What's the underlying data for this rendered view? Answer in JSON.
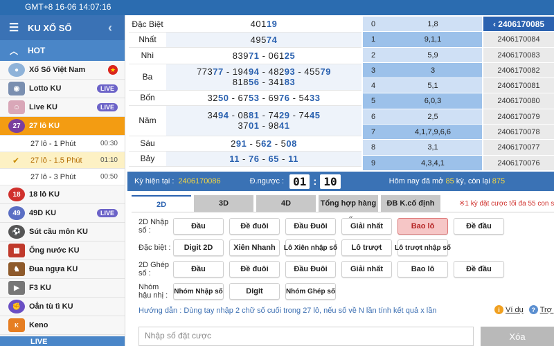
{
  "topbar": {
    "time": "GMT+8 16-06 14:07:16"
  },
  "sidebar": {
    "title": "KU XỔ SỐ",
    "hot_label": "HOT",
    "items": [
      {
        "label": "Xổ Số Việt Nam",
        "icon": "vietnam-flag-icon",
        "badge": ""
      },
      {
        "label": "Lotto KU",
        "icon": "lotto-icon",
        "badge": "LIVE"
      },
      {
        "label": "Live KU",
        "icon": "live-host-icon",
        "badge": "LIVE"
      },
      {
        "label": "27 lô KU",
        "icon": "27-lo-icon",
        "badge": ""
      }
    ],
    "sub_items": [
      {
        "label": "27 lô - 1 Phút",
        "time": "00:30"
      },
      {
        "label": "27 lô - 1.5 Phút",
        "time": "01:10"
      },
      {
        "label": "27 lô - 3 Phút",
        "time": "00:50"
      }
    ],
    "items2": [
      {
        "label": "18 lô KU",
        "badge": ""
      },
      {
        "label": "49D KU",
        "badge": "LIVE"
      },
      {
        "label": "Sút cầu môn KU",
        "badge": ""
      },
      {
        "label": "Ống nước KU",
        "badge": ""
      },
      {
        "label": "Đua ngựa KU",
        "badge": ""
      },
      {
        "label": "F3 KU",
        "badge": ""
      },
      {
        "label": "Oẳn tù tì KU",
        "badge": ""
      },
      {
        "label": "Keno",
        "badge": ""
      }
    ],
    "bottom_label": "LIVE"
  },
  "results": [
    {
      "label": "Đặc Biệt",
      "lines": [
        [
          "401",
          "19"
        ]
      ]
    },
    {
      "label": "Nhất",
      "lines": [
        [
          "495",
          "74"
        ]
      ]
    },
    {
      "label": "Nhì",
      "lines": [
        [
          "839",
          "71",
          " - ",
          "061",
          "25"
        ]
      ]
    },
    {
      "label": "Ba",
      "lines": [
        [
          "773",
          "77",
          " - ",
          "194",
          "94",
          " - ",
          "482",
          "93",
          " - ",
          "455",
          "79"
        ],
        [
          "818",
          "56",
          " - ",
          "341",
          "83"
        ]
      ]
    },
    {
      "label": "Bốn",
      "lines": [
        [
          "32",
          "50",
          " - ",
          "67",
          "53",
          " - ",
          "69",
          "76",
          " - ",
          "54",
          "33"
        ]
      ]
    },
    {
      "label": "Năm",
      "lines": [
        [
          "34",
          "94",
          " - ",
          "08",
          "81",
          " - ",
          "74",
          "29",
          " - ",
          "74",
          "45"
        ],
        [
          "37",
          "01",
          " - ",
          "98",
          "41"
        ]
      ]
    },
    {
      "label": "Sáu",
      "lines": [
        [
          "2",
          "91",
          " - ",
          "5",
          "62",
          " - ",
          "5",
          "08"
        ]
      ]
    },
    {
      "label": "Bảy",
      "lines": [
        [
          "",
          "11",
          " - ",
          "",
          "76",
          " - ",
          "",
          "65",
          " - ",
          "",
          "11"
        ]
      ]
    }
  ],
  "history": [
    {
      "idx": "0",
      "value": "1,8",
      "id": "2406170085"
    },
    {
      "idx": "1",
      "value": "9,1,1",
      "id": "2406170084"
    },
    {
      "idx": "2",
      "value": "5,9",
      "id": "2406170083"
    },
    {
      "idx": "3",
      "value": "3",
      "id": "2406170082"
    },
    {
      "idx": "4",
      "value": "5,1",
      "id": "2406170081"
    },
    {
      "idx": "5",
      "value": "6,0,3",
      "id": "2406170080"
    },
    {
      "idx": "6",
      "value": "2,5",
      "id": "2406170079"
    },
    {
      "idx": "7",
      "value": "4,1,7,9,6,6",
      "id": "2406170078"
    },
    {
      "idx": "8",
      "value": "3,1",
      "id": "2406170077"
    },
    {
      "idx": "9",
      "value": "4,3,4,1",
      "id": "2406170076"
    }
  ],
  "status": {
    "current_label": "Kỳ hiện tại :",
    "current_value": "2406170086",
    "countdown_label": "Đ.ngược :",
    "minutes": "01",
    "seconds": "10",
    "today_prefix": "Hôm nay đã mở",
    "opened": "85",
    "today_mid": "kỳ, còn lại",
    "remaining": "875"
  },
  "tabs": [
    "2D",
    "3D",
    "4D",
    "Tổng hợp hàng số",
    "ĐB K.cố định"
  ],
  "warning": "※1 kỳ đặt cược tối đa 55 con số",
  "bet_rows": [
    {
      "label": "2D Nhập số :",
      "buttons": [
        "Đầu",
        "Đề đuôi",
        "Đầu Đuôi",
        "Giải nhất",
        "Bao lô",
        "Đề đầu"
      ]
    },
    {
      "label": "Đặc biệt :",
      "buttons": [
        "Digit 2D",
        "Xiên Nhanh",
        "Lô Xiên nhập số",
        "Lô trượt",
        "Lô trượt nhập số"
      ]
    },
    {
      "label": "2D Ghép số :",
      "buttons": [
        "Đầu",
        "Đề đuôi",
        "Đầu Đuôi",
        "Giải nhất",
        "Bao lô",
        "Đề đầu"
      ]
    },
    {
      "label": "Nhóm hậu nhị :",
      "buttons": [
        "Nhóm Nhập số",
        "Digit",
        "Nhóm Ghép số"
      ]
    }
  ],
  "guide": "Hướng dẫn : Dùng tay nhập 2 chữ số cuối trong 27 lô, nếu số về N lần tính kết quả x lần",
  "help": {
    "example": "Ví dụ",
    "help": "Trợ giúp"
  },
  "input": {
    "placeholder": "Nhập số đặt cược"
  },
  "clear_label": "Xóa"
}
